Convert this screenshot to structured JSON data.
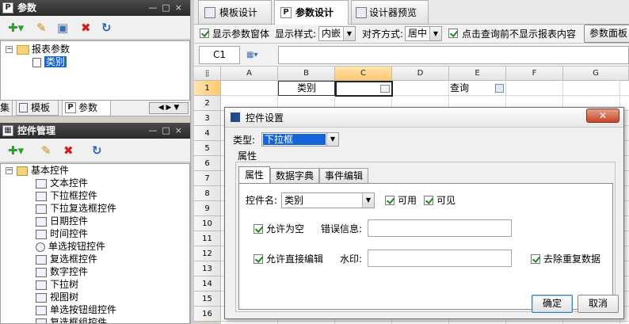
{
  "param_panel": {
    "title": "参数",
    "tree": {
      "root": "报表参数",
      "child": "类别"
    },
    "tabs": [
      "集",
      "模板",
      "参数"
    ]
  },
  "control_panel": {
    "title": "控件管理",
    "root": "基本控件",
    "items": [
      "文本控件",
      "下拉框控件",
      "下拉复选框控件",
      "日期控件",
      "时间控件",
      "单选按钮控件",
      "复选框控件",
      "数字控件",
      "下拉树",
      "视图树",
      "单选按钮组控件",
      "复选框组控件"
    ]
  },
  "designer_tabs": [
    "模板设计",
    "参数设计",
    "设计器预览"
  ],
  "options": {
    "show_param_window": "显示参数窗体",
    "display_style_label": "显示样式:",
    "display_style": "内嵌",
    "align_label": "对齐方式:",
    "align": "居中",
    "hide_before_query": "点击查询前不显示报表内容",
    "param_panel_button": "参数面板"
  },
  "cell_ref": "C1",
  "grid": {
    "columns": [
      "A",
      "B",
      "C",
      "D",
      "E",
      "F",
      "G"
    ],
    "rows": [
      "1",
      "2",
      "3",
      "4",
      "5",
      "6",
      "7",
      "8",
      "9",
      "10",
      "11",
      "12",
      "13",
      "14",
      "15",
      "16"
    ],
    "b1": "类别",
    "e1": "查询"
  },
  "dialog": {
    "title": "控件设置",
    "type_label": "类型:",
    "type_value": "下拉框",
    "group_label": "属性",
    "tabs": [
      "属性",
      "数据字典",
      "事件编辑"
    ],
    "name_label": "控件名:",
    "name_value": "类别",
    "enabled": "可用",
    "visible": "可见",
    "allow_empty": "允许为空",
    "error_label": "错误信息:",
    "error_value": "",
    "allow_edit": "允许直接编辑",
    "watermark_label": "水印:",
    "watermark_value": "",
    "remove_dup": "去除重复数据",
    "ok": "确定",
    "cancel": "取消"
  },
  "colors": {
    "accent": "#ffd89a",
    "select_blue": "#1565d8",
    "title_dark": "#333333"
  }
}
